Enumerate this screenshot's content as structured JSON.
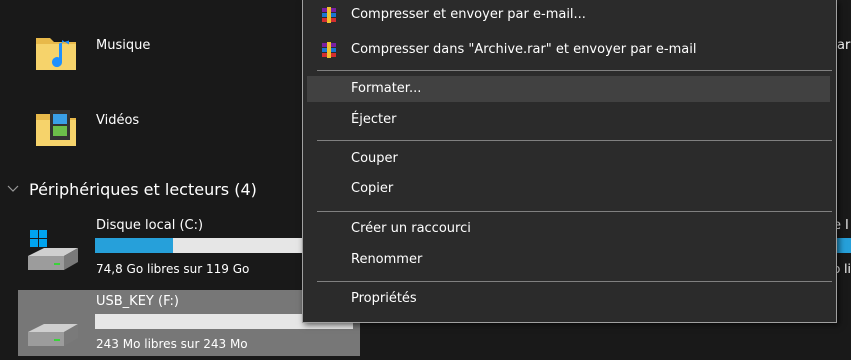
{
  "left_panel": {
    "folders": [
      {
        "label": "Musique",
        "icon": "music-folder-icon"
      },
      {
        "label": "Vidéos",
        "icon": "videos-folder-icon"
      }
    ],
    "section_title": "Périphériques et lecteurs (4)",
    "drives": [
      {
        "label": "Disque local (C:)",
        "free_text": "74,8 Go libres sur 119 Go",
        "used_fraction": 0.37,
        "icon": "windows-drive-icon"
      },
      {
        "label": "USB_KEY (F:)",
        "free_text": "243 Mo libres sur 243 Mo",
        "used_fraction": 0.0,
        "icon": "usb-drive-icon"
      }
    ],
    "right_edge_fragments": [
      "ar",
      "e l",
      "o li"
    ]
  },
  "context_menu": {
    "items": [
      {
        "label": "Compresser et envoyer par e-mail...",
        "icon": "winrar-icon"
      },
      {
        "label": "Compresser dans \"Archive.rar\" et envoyer par e-mail",
        "icon": "winrar-icon"
      },
      {
        "label": "Formater..."
      },
      {
        "label": "Éjecter"
      },
      {
        "label": "Couper"
      },
      {
        "label": "Copier"
      },
      {
        "label": "Créer un raccourci"
      },
      {
        "label": "Renommer"
      },
      {
        "label": "Propriétés"
      }
    ]
  },
  "colors": {
    "background": "#191919",
    "menu_background": "#2b2b2b",
    "menu_hover": "#414141",
    "bar_fill": "#26a0da",
    "bar_track": "#e6e6e6",
    "selected_drive": "#777777"
  }
}
